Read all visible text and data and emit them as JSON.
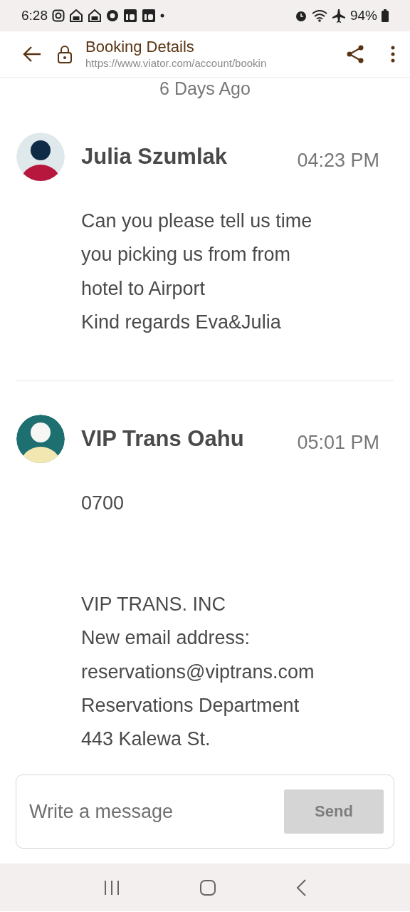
{
  "status_bar": {
    "time": "6:28",
    "battery": "94%"
  },
  "toolbar": {
    "title": "Booking Details",
    "url": "https://www.viator.com/account/bookin"
  },
  "date_divider": "6 Days Ago",
  "messages": [
    {
      "sender": "Julia Szumlak",
      "time": "04:23 PM",
      "color": "#b8173d",
      "body": "Can you please tell us time\nyou picking us from from\nhotel to Airport\nKind regards Eva&Julia"
    },
    {
      "sender": "VIP Trans Oahu",
      "time": "05:01 PM",
      "color": "#f2e7b0",
      "body": "0700\n\n\nVIP TRANS. INC\nNew email address:\nreservations@viptrans.com\nReservations Department\n443 Kalewa St."
    }
  ],
  "composer": {
    "placeholder": "Write a message",
    "send": "Send"
  }
}
